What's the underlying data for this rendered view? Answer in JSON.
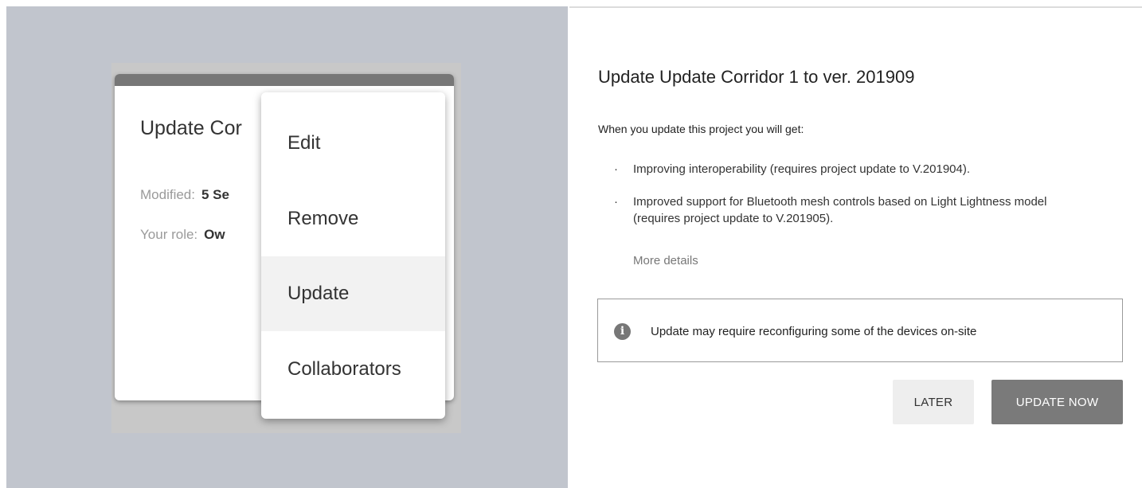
{
  "illustration": {
    "card": {
      "title": "Update Cor",
      "modified_label": "Modified:",
      "modified_value": "5 Se",
      "role_label": "Your role:",
      "role_value": "Ow"
    },
    "menu": {
      "items": [
        {
          "label": "Edit"
        },
        {
          "label": "Remove"
        },
        {
          "label": "Update",
          "highlighted": true
        },
        {
          "label": "Collaborators"
        }
      ]
    }
  },
  "dialog": {
    "title": "Update Update Corridor 1 to ver. 201909",
    "intro": "When you update this project you will get:",
    "bullet_glyph": "·",
    "bullets": [
      "Improving interoperability (requires project update to V.201904).",
      "Improved support for Bluetooth mesh controls based on Light Lightness model (requires project update to V.201905)."
    ],
    "more_details": "More details",
    "notice": {
      "icon": "info-icon",
      "icon_glyph": "i",
      "text": "Update may require reconfiguring some of the devices on-site"
    },
    "buttons": {
      "later": "LATER",
      "update_now": "UPDATE NOW"
    }
  },
  "colors": {
    "left_background": "#c1c5cd",
    "primary_button": "#7a7a7a",
    "secondary_button": "#eeeeee",
    "menu_highlight": "#f2f2f2"
  }
}
